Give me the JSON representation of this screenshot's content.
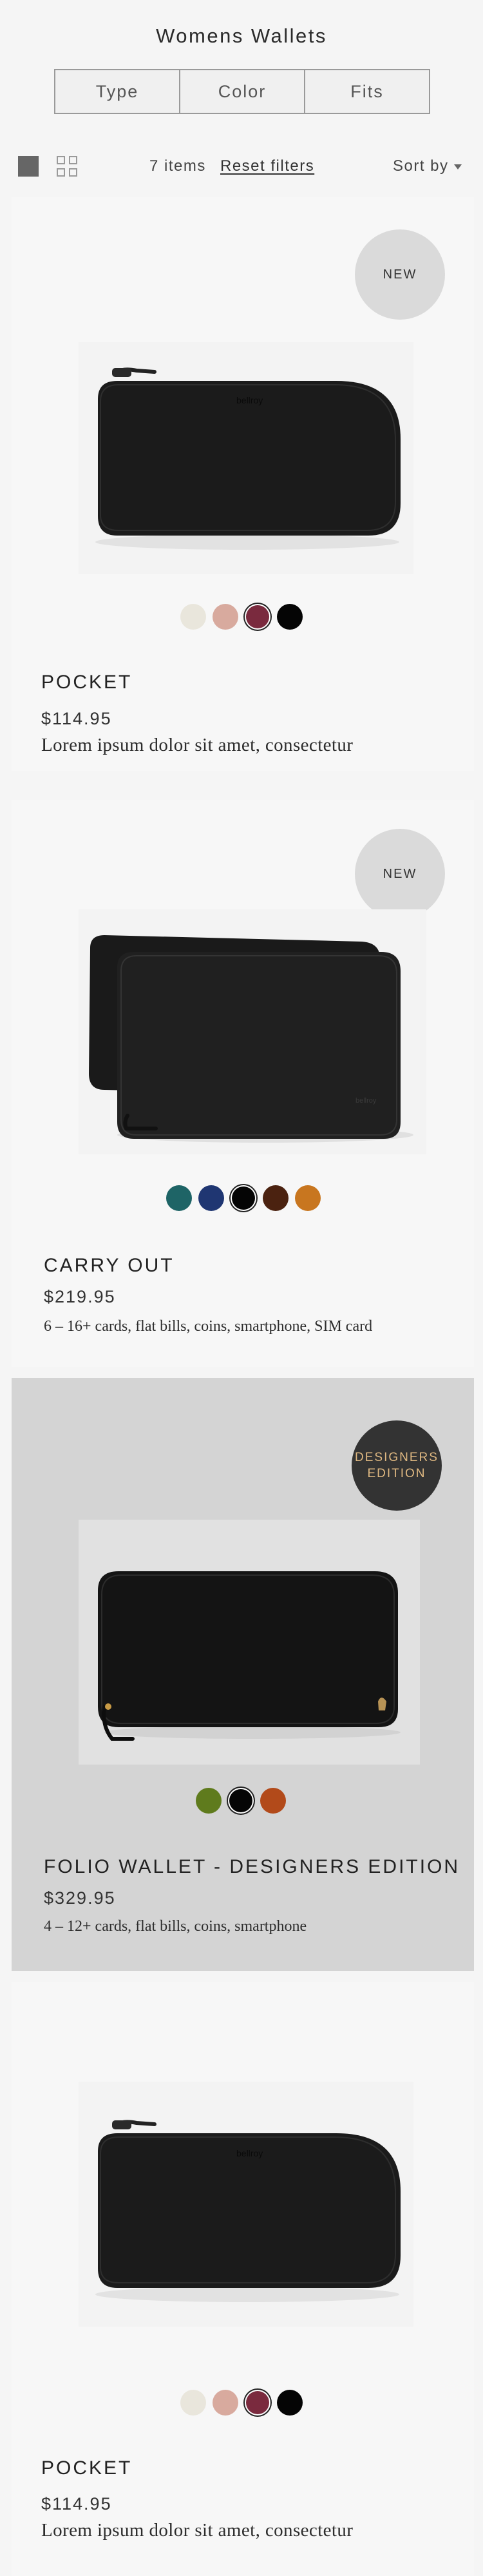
{
  "header": {
    "title": "Womens Wallets"
  },
  "filters": [
    {
      "label": "Type"
    },
    {
      "label": "Color"
    },
    {
      "label": "Fits"
    }
  ],
  "toolbar": {
    "items_count": "7 items",
    "reset_label": "Reset filters",
    "sort_label": "Sort by"
  },
  "products": [
    {
      "badge": "NEW",
      "image_icon": "wallet-pocket-image",
      "swatches": [
        {
          "color": "#e9e6dc",
          "selected": false
        },
        {
          "color": "#d8aa9e",
          "selected": false
        },
        {
          "color": "#7a2a3e",
          "selected": true
        },
        {
          "color": "#050505",
          "selected": false
        }
      ],
      "name": "POCKET",
      "price": "$114.95",
      "description": "Lorem ipsum dolor sit amet, consectetur"
    },
    {
      "badge": "NEW",
      "image_icon": "wallet-carry-out-image",
      "swatches": [
        {
          "color": "#1e6466",
          "selected": false
        },
        {
          "color": "#1f3672",
          "selected": false
        },
        {
          "color": "#050505",
          "selected": true
        },
        {
          "color": "#4b2210",
          "selected": false
        },
        {
          "color": "#c8761f",
          "selected": false
        }
      ],
      "name": "CARRY OUT",
      "price": "$219.95",
      "description": "6 – 16+ cards, flat bills, coins, smartphone, SIM card"
    },
    {
      "badge": "DESIGNERS EDITION",
      "badge_line1": "DESIGNERS",
      "badge_line2": "EDITION",
      "image_icon": "wallet-folio-image",
      "swatches": [
        {
          "color": "#5f7b1d",
          "selected": false
        },
        {
          "color": "#050505",
          "selected": true
        },
        {
          "color": "#b24a1a",
          "selected": false
        }
      ],
      "name": "FOLIO WALLET - DESIGNERS EDITION",
      "price": "$329.95",
      "description": "4 – 12+ cards, flat bills, coins, smartphone"
    },
    {
      "image_icon": "wallet-pocket-image",
      "swatches": [
        {
          "color": "#e9e6dc",
          "selected": false
        },
        {
          "color": "#d8aa9e",
          "selected": false
        },
        {
          "color": "#7a2a3e",
          "selected": true
        },
        {
          "color": "#050505",
          "selected": false
        }
      ],
      "name": "POCKET",
      "price": "$114.95",
      "description": "Lorem ipsum dolor sit amet, consectetur"
    }
  ],
  "colors": {
    "background": "#f5f5f5",
    "card": "#f7f7f7",
    "card_highlight": "#d4d4d4",
    "badge_new": "#dadada",
    "badge_designers": "#333333",
    "badge_designers_text": "#e0b982"
  }
}
